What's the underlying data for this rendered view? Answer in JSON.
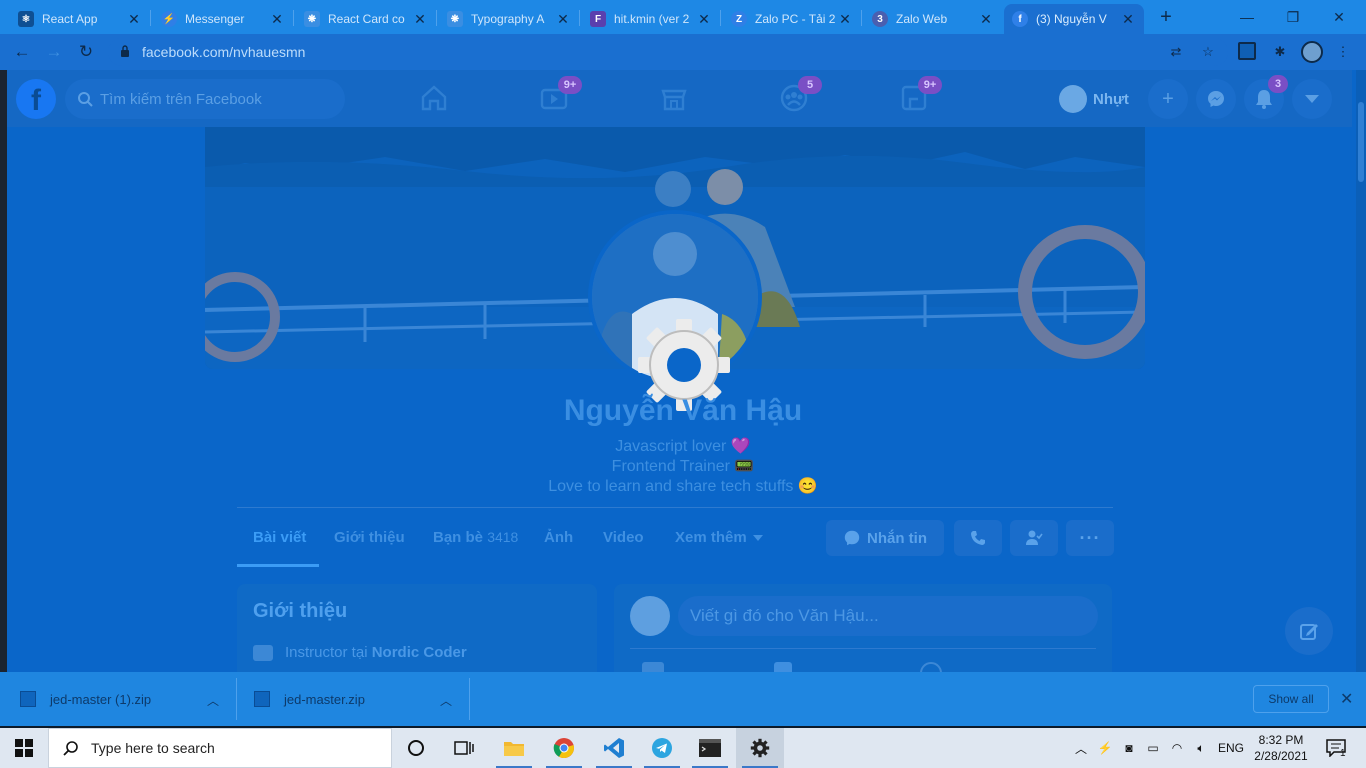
{
  "browser": {
    "tabs": [
      {
        "title": "React App",
        "icon": "react-icon"
      },
      {
        "title": "Messenger",
        "icon": "messenger-icon"
      },
      {
        "title": "React Card co",
        "icon": "react-card-icon"
      },
      {
        "title": "Typography A",
        "icon": "typography-icon"
      },
      {
        "title": "hit.kmin (ver 2",
        "icon": "figma-icon"
      },
      {
        "title": "Zalo PC - Tải 2",
        "icon": "zalo-icon"
      },
      {
        "title": "Zalo Web",
        "icon": "zalo-web-icon"
      },
      {
        "title": "(3) Nguyễn V",
        "icon": "facebook-icon",
        "active": true
      }
    ],
    "url": "facebook.com/nvhauesmn"
  },
  "facebook": {
    "search_placeholder": "Tìm kiếm trên Facebook",
    "badges": {
      "watch": "9+",
      "groups": "5",
      "gaming": "9+",
      "notifications": "3"
    },
    "user_name": "Nhựt",
    "profile": {
      "name": "Nguyễn Văn Hậu",
      "bio": [
        "Javascript lover 💜",
        "Frontend Trainer 📟",
        "Love to learn and share tech stuffs 😊"
      ]
    },
    "tabs": {
      "posts": "Bài viết",
      "about": "Giới thiệu",
      "friends": "Bạn bè",
      "friends_count": "3418",
      "photos": "Ảnh",
      "videos": "Video",
      "more": "Xem thêm"
    },
    "message_button": "Nhắn tin",
    "intro": {
      "title": "Giới thiệu",
      "job_prefix": "Instructor tại ",
      "job_company": "Nordic Coder"
    },
    "composer_placeholder": "Viết gì đó cho Văn Hậu..."
  },
  "downloads": {
    "items": [
      "jed-master (1).zip",
      "jed-master.zip"
    ],
    "show_all": "Show all"
  },
  "taskbar": {
    "search_placeholder": "Type here to search",
    "language": "ENG",
    "time": "8:32 PM",
    "date": "2/28/2021",
    "notification_count": "1"
  },
  "colors": {
    "overlay_blue": "#0a66c9",
    "chrome_blue": "#1e88e5",
    "taskbar": "#dfe7f1"
  }
}
